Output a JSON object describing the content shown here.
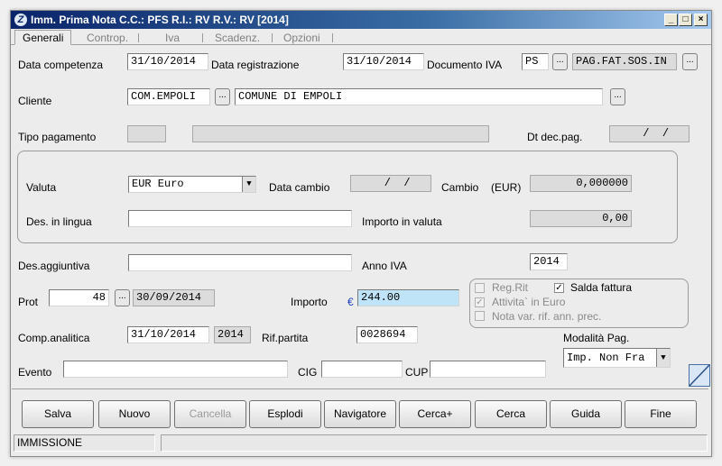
{
  "window": {
    "title": "Imm. Prima Nota C.C.: PFS  R.I.: RV  R.V.: RV  [2014]",
    "controls": {
      "minimize": "_",
      "maximize": "□",
      "close": "×"
    }
  },
  "tabs": [
    {
      "label": "Generali"
    },
    {
      "label": "Controp."
    },
    {
      "label": "Iva"
    },
    {
      "label": "Scadenz."
    },
    {
      "label": "Opzioni"
    }
  ],
  "form": {
    "data_competenza": {
      "label": "Data competenza",
      "value": "31/10/2014"
    },
    "data_registrazione": {
      "label": "Data registrazione",
      "value": "31/10/2014"
    },
    "documento_iva": {
      "label": "Documento IVA",
      "code": "PS",
      "desc": "PAG.FAT.SOS.IN"
    },
    "cliente": {
      "label": "Cliente",
      "code": "COM.EMPOLI",
      "name": "COMUNE DI EMPOLI"
    },
    "tipo_pagamento": {
      "label": "Tipo pagamento"
    },
    "dt_dec_pag": {
      "label": "Dt dec.pag.",
      "value": "  /  /"
    },
    "valuta": {
      "label": "Valuta",
      "value": "EUR Euro"
    },
    "data_cambio": {
      "label": "Data cambio",
      "value": "  /  /"
    },
    "cambio": {
      "label": "Cambio",
      "currency": "(EUR)",
      "value": "0,000000"
    },
    "des_lingua": {
      "label": "Des. in lingua"
    },
    "importo_valuta": {
      "label": "Importo in valuta",
      "value": "0,00"
    },
    "des_aggiuntiva": {
      "label": "Des.aggiuntiva"
    },
    "anno_iva": {
      "label": "Anno IVA",
      "value": "2014"
    },
    "prot": {
      "label": "Prot",
      "value": "48",
      "date": "30/09/2014"
    },
    "importo": {
      "label": "Importo",
      "currency_icon": "€",
      "value": "244.00"
    },
    "reg_rit": {
      "label": "Reg.Rit",
      "checked": false
    },
    "salda_fattura": {
      "label": "Salda fattura",
      "checked": true
    },
    "attivita_euro": {
      "label": "Attivita` in Euro",
      "checked": true
    },
    "nota_var": {
      "label": "Nota var. rif. ann. prec.",
      "checked": false
    },
    "comp_analitica": {
      "label": "Comp.analitica",
      "value": "31/10/2014",
      "year": "2014"
    },
    "rif_partita": {
      "label": "Rif.partita",
      "value": "0028694"
    },
    "modalita_pag": {
      "label": "Modalità Pag.",
      "value": "Imp. Non Fra"
    },
    "evento": {
      "label": "Evento"
    },
    "cig": {
      "label": "CIG"
    },
    "cup": {
      "label": "CUP"
    },
    "dots_label": "...",
    "check_mark": "✓",
    "combo_arrow": "▼"
  },
  "buttons": [
    {
      "label": "Salva",
      "enabled": true
    },
    {
      "label": "Nuovo",
      "enabled": true
    },
    {
      "label": "Cancella",
      "enabled": false
    },
    {
      "label": "Esplodi",
      "enabled": true
    },
    {
      "label": "Navigatore",
      "enabled": true
    },
    {
      "label": "Cerca+",
      "enabled": true
    },
    {
      "label": "Cerca",
      "enabled": true
    },
    {
      "label": "Guida",
      "enabled": true
    },
    {
      "label": "Fine",
      "enabled": true
    }
  ],
  "status": {
    "mode": "IMMISSIONE",
    "message": ""
  }
}
